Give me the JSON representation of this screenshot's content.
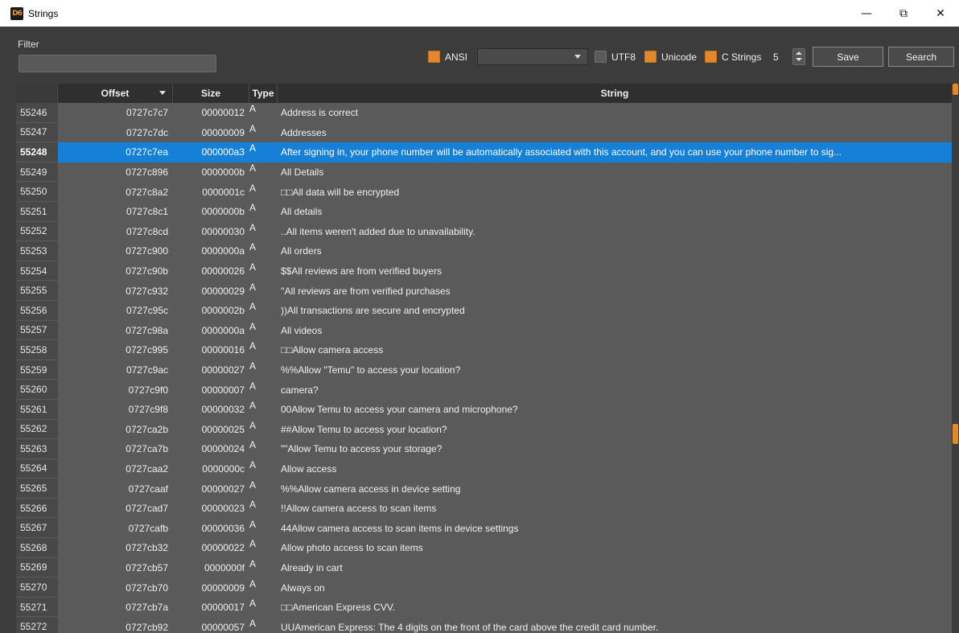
{
  "window": {
    "title": "Strings",
    "icon_text": "D6",
    "controls": {
      "minimize": "—",
      "maximize": "⧉",
      "close": "✕"
    }
  },
  "toolbar": {
    "filter_label": "Filter",
    "filter_value": "",
    "ansi_label": "ANSI",
    "ansi_checked": true,
    "encoding_dropdown_value": "",
    "utf8_label": "UTF8",
    "utf8_checked": false,
    "unicode_label": "Unicode",
    "unicode_checked": true,
    "cstrings_label": "C Strings",
    "cstrings_checked": true,
    "min_length": "5",
    "save_label": "Save",
    "search_label": "Search"
  },
  "table": {
    "columns": [
      "",
      "Offset",
      "Size",
      "Type",
      "String"
    ],
    "sorted_column": "Offset",
    "selected_row": "55248",
    "rows": [
      {
        "num": "55246",
        "offset": "0727c7c7",
        "size": "00000012",
        "type": "A",
        "string": "Address is correct"
      },
      {
        "num": "55247",
        "offset": "0727c7dc",
        "size": "00000009",
        "type": "A",
        "string": "Addresses"
      },
      {
        "num": "55248",
        "offset": "0727c7ea",
        "size": "000000a3",
        "type": "A",
        "string": "After signing in, your phone number will be automatically associated with this account, and you can use your phone number to sig..."
      },
      {
        "num": "55249",
        "offset": "0727c896",
        "size": "0000000b",
        "type": "A",
        "string": "All Details"
      },
      {
        "num": "55250",
        "offset": "0727c8a2",
        "size": "0000001c",
        "type": "A",
        "string": "□□All data will be encrypted"
      },
      {
        "num": "55251",
        "offset": "0727c8c1",
        "size": "0000000b",
        "type": "A",
        "string": "All details"
      },
      {
        "num": "55252",
        "offset": "0727c8cd",
        "size": "00000030",
        "type": "A",
        "string": "..All items weren't added due to unavailability."
      },
      {
        "num": "55253",
        "offset": "0727c900",
        "size": "0000000a",
        "type": "A",
        "string": "All orders"
      },
      {
        "num": "55254",
        "offset": "0727c90b",
        "size": "00000026",
        "type": "A",
        "string": "$$All reviews are from verified buyers"
      },
      {
        "num": "55255",
        "offset": "0727c932",
        "size": "00000029",
        "type": "A",
        "string": "''All reviews are from verified purchases"
      },
      {
        "num": "55256",
        "offset": "0727c95c",
        "size": "0000002b",
        "type": "A",
        "string": "))All transactions are secure and encrypted"
      },
      {
        "num": "55257",
        "offset": "0727c98a",
        "size": "0000000a",
        "type": "A",
        "string": "All videos"
      },
      {
        "num": "55258",
        "offset": "0727c995",
        "size": "00000016",
        "type": "A",
        "string": "□□Allow  camera access"
      },
      {
        "num": "55259",
        "offset": "0727c9ac",
        "size": "00000027",
        "type": "A",
        "string": "%%Allow \"Temu\" to access your location?"
      },
      {
        "num": "55260",
        "offset": "0727c9f0",
        "size": "00000007",
        "type": "A",
        "string": "camera?"
      },
      {
        "num": "55261",
        "offset": "0727c9f8",
        "size": "00000032",
        "type": "A",
        "string": "00Allow Temu to access your camera and microphone?"
      },
      {
        "num": "55262",
        "offset": "0727ca2b",
        "size": "00000025",
        "type": "A",
        "string": "##Allow Temu to access your location?"
      },
      {
        "num": "55263",
        "offset": "0727ca7b",
        "size": "00000024",
        "type": "A",
        "string": "\"\"Allow Temu to access your storage?"
      },
      {
        "num": "55264",
        "offset": "0727caa2",
        "size": "0000000c",
        "type": "A",
        "string": "Allow access"
      },
      {
        "num": "55265",
        "offset": "0727caaf",
        "size": "00000027",
        "type": "A",
        "string": "%%Allow camera access in device setting"
      },
      {
        "num": "55266",
        "offset": "0727cad7",
        "size": "00000023",
        "type": "A",
        "string": "!!Allow camera access to scan items"
      },
      {
        "num": "55267",
        "offset": "0727cafb",
        "size": "00000036",
        "type": "A",
        "string": "44Allow camera access to scan items in device settings"
      },
      {
        "num": "55268",
        "offset": "0727cb32",
        "size": "00000022",
        "type": "A",
        "string": "  Allow photo access to scan items"
      },
      {
        "num": "55269",
        "offset": "0727cb57",
        "size": "0000000f",
        "type": "A",
        "string": "Already in cart"
      },
      {
        "num": "55270",
        "offset": "0727cb70",
        "size": "00000009",
        "type": "A",
        "string": "Always on"
      },
      {
        "num": "55271",
        "offset": "0727cb7a",
        "size": "00000017",
        "type": "A",
        "string": "□□American Express CVV."
      },
      {
        "num": "55272",
        "offset": "0727cb92",
        "size": "00000057",
        "type": "A",
        "string": "UUAmerican Express: The 4 digits on the front of the card above the credit card number."
      }
    ]
  },
  "colors": {
    "accent": "#e0882a",
    "selection": "#1680d6",
    "background": "#3c3c3c",
    "table_bg": "#5a5a5a"
  }
}
